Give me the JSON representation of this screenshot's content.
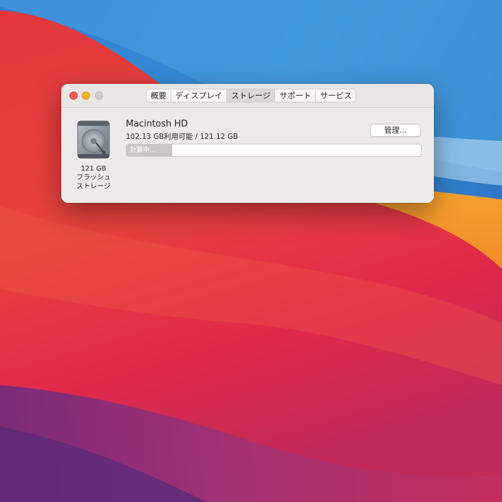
{
  "window": {
    "tabs": [
      {
        "label": "概要"
      },
      {
        "label": "ディスプレイ"
      },
      {
        "label": "ストレージ"
      },
      {
        "label": "サポート"
      },
      {
        "label": "サービス"
      }
    ],
    "active_tab": "ストレージ"
  },
  "disk": {
    "capacity": "121 GB",
    "type_line1": "フラッシュ",
    "type_line2": "ストレージ",
    "icon": "internal-drive-icon"
  },
  "volume": {
    "name": "Macintosh HD",
    "usage": "102.13 GB利用可能 / 121.12 GB",
    "manage_label": "管理...",
    "bar_status": "計算中..."
  },
  "colors": {
    "close": "#ee5a52",
    "minimize": "#f1b62b",
    "zoom": "#cfcdcc",
    "window_bg": "#ecebea"
  }
}
